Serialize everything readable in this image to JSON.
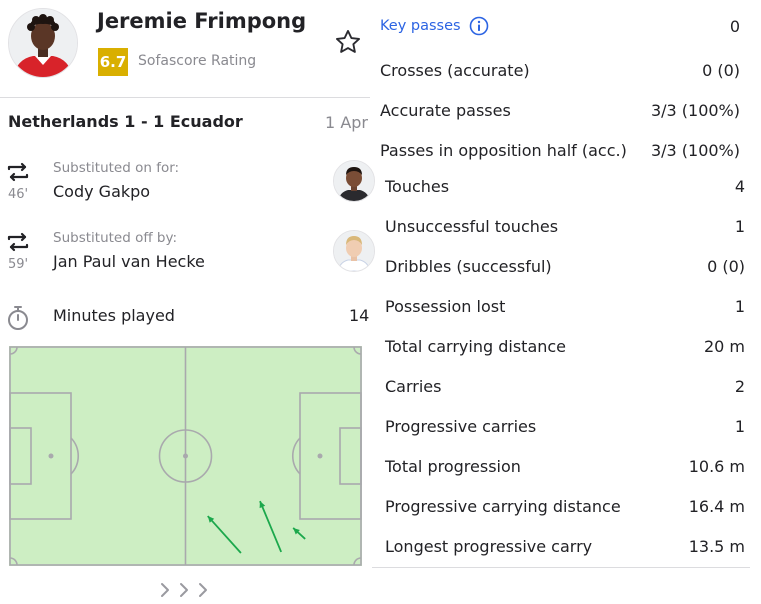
{
  "player": {
    "name": "Jeremie Frimpong",
    "rating": "6.7",
    "rating_label": "Sofascore Rating",
    "rating_color": "#d9af00"
  },
  "match": {
    "title": "Netherlands 1 - 1 Ecuador",
    "date": "1 Apr"
  },
  "substitutions": [
    {
      "minute": "46'",
      "caption": "Substituted on for:",
      "player": "Cody Gakpo"
    },
    {
      "minute": "59'",
      "caption": "Substituted off by:",
      "player": "Jan Paul van Hecke"
    }
  ],
  "minutes_played": {
    "label": "Minutes played",
    "value": "14"
  },
  "pitch": {
    "color": "#cdeec3",
    "line_color": "#a9a9ad",
    "arrow_color": "#1ca84c",
    "carries": [
      {
        "from": [
          0.657,
          0.941
        ],
        "to": [
          0.563,
          0.773
        ]
      },
      {
        "from": [
          0.771,
          0.936
        ],
        "to": [
          0.711,
          0.705
        ]
      },
      {
        "from": [
          0.839,
          0.877
        ],
        "to": [
          0.805,
          0.827
        ]
      }
    ]
  },
  "pagination": {
    "icon": "chevron-right-icons"
  },
  "stats": [
    {
      "label": "Key passes",
      "value": "0",
      "link": true
    },
    {
      "label": "Crosses (accurate)",
      "value": "0 (0)"
    },
    {
      "label": "Accurate passes",
      "value": "3/3 (100%)"
    },
    {
      "label": "Passes in opposition half (acc.)",
      "value": "3/3 (100%)"
    },
    {
      "label": "Touches",
      "value": "4"
    },
    {
      "label": "Unsuccessful touches",
      "value": "1"
    },
    {
      "label": "Dribbles (successful)",
      "value": "0 (0)"
    },
    {
      "label": "Possession lost",
      "value": "1"
    },
    {
      "label": "Total carrying distance",
      "value": "20 m"
    },
    {
      "label": "Carries",
      "value": "2"
    },
    {
      "label": "Progressive carries",
      "value": "1"
    },
    {
      "label": "Total progression",
      "value": "10.6 m"
    },
    {
      "label": "Progressive carrying distance",
      "value": "16.4 m"
    },
    {
      "label": "Longest progressive carry",
      "value": "13.5 m"
    }
  ]
}
